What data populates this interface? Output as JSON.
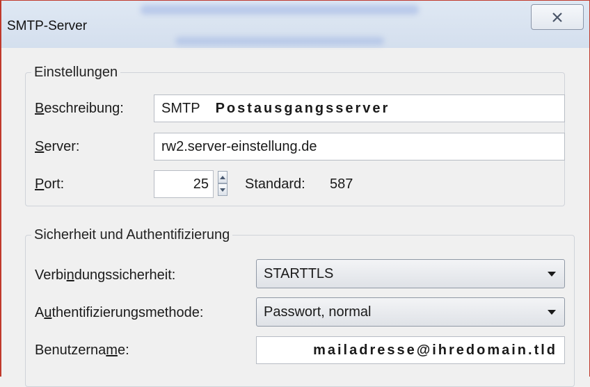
{
  "window": {
    "title": "SMTP-Server"
  },
  "settings": {
    "legend": "Einstellungen",
    "description": {
      "label_u": "B",
      "label_rest": "eschreibung:",
      "value_prefix": "SMTP",
      "value_bold": "Postausgangsserver"
    },
    "server": {
      "label_u": "S",
      "label_rest": "erver:",
      "value": "rw2.server-einstellung.de"
    },
    "port": {
      "label_u": "P",
      "label_rest": "ort:",
      "value": "25",
      "default_text": "Standard:",
      "default_value": "587"
    }
  },
  "security": {
    "legend": "Sicherheit und Authentifizierung",
    "connection": {
      "label_pre": "Verbi",
      "label_u": "n",
      "label_post": "dungssicherheit:",
      "value": "STARTTLS"
    },
    "auth": {
      "label_pre": "A",
      "label_u": "u",
      "label_post": "thentifizierungsmethode:",
      "value": "Passwort, normal"
    },
    "username": {
      "label_pre": "Benutzerna",
      "label_u": "m",
      "label_post": "e:",
      "value": "mailadresse@ihredomain.tld"
    }
  },
  "colors": {
    "accent_border": "#c0392b",
    "titlebar": "#d4dfee"
  }
}
